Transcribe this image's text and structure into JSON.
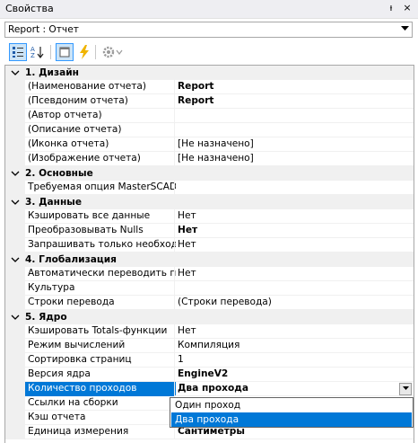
{
  "window": {
    "title": "Свойства",
    "pin_glyph": "ᵼ",
    "close_glyph": "×"
  },
  "object_selector": {
    "value": "Report : Отчет"
  },
  "toolbar": {
    "buttons": [
      "categorized-icon",
      "alphabetical-icon",
      "property-pages-icon",
      "events-icon",
      "settings-icon"
    ]
  },
  "categories": [
    {
      "label": "1. Дизайн"
    },
    {
      "label": "2. Основные"
    },
    {
      "label": "3. Данные"
    },
    {
      "label": "4. Глобализация"
    },
    {
      "label": "5. Ядро"
    }
  ],
  "rows": [
    {
      "name": "(Наименование отчета)",
      "value": "Report"
    },
    {
      "name": "(Псевдоним отчета)",
      "value": "Report"
    },
    {
      "name": "(Автор отчета)",
      "value": ""
    },
    {
      "name": "(Описание отчета)",
      "value": ""
    },
    {
      "name": "(Иконка отчета)",
      "value": "[Не назначено]"
    },
    {
      "name": "(Изображение отчета)",
      "value": "[Не назначено]"
    },
    {
      "name": "Требуемая опция MasterSCADA",
      "value": ""
    },
    {
      "name": "Кэшировать все данные",
      "value": "Нет"
    },
    {
      "name": "Преобразовывать Nulls",
      "value": "Нет"
    },
    {
      "name": "Запрашивать только необходимые",
      "value": "Нет"
    },
    {
      "name": "Автоматически переводить при",
      "value": "Нет"
    },
    {
      "name": "Культура",
      "value": ""
    },
    {
      "name": "Строки перевода",
      "value": "(Строки перевода)"
    },
    {
      "name": "Кэшировать Totals-функции",
      "value": "Нет"
    },
    {
      "name": "Режим вычислений",
      "value": "Компиляция"
    },
    {
      "name": "Сортировка страниц",
      "value": "1"
    },
    {
      "name": "Версия ядра",
      "value": "EngineV2"
    },
    {
      "name": "Количество проходов",
      "value": "Два прохода"
    },
    {
      "name": "Ссылки на сборки",
      "value": ""
    },
    {
      "name": "Кэш отчета",
      "value": ""
    },
    {
      "name": "Единица измерения",
      "value": "Сантиметры"
    }
  ],
  "dropdown": {
    "options": [
      "Один проход",
      "Два прохода"
    ],
    "highlighted": "Два прохода"
  },
  "colors": {
    "selection": "#0078d7",
    "category_bg": "#f0f0f0"
  }
}
